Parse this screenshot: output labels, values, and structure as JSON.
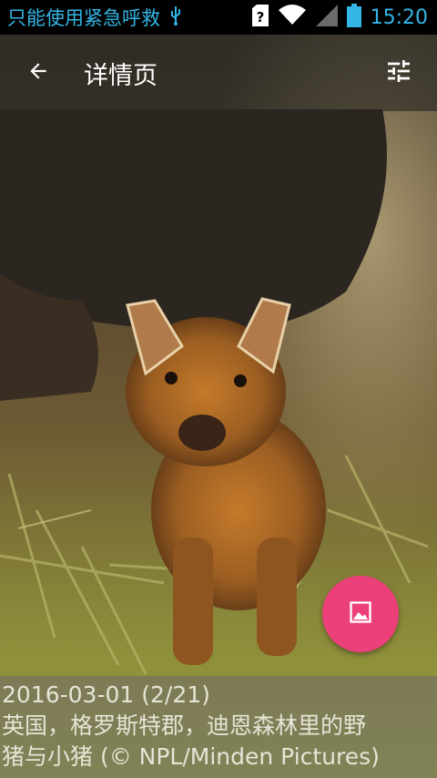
{
  "status_bar": {
    "carrier_text": "只能使用紧急呼救",
    "time": "15:20",
    "icons": [
      "usb-icon",
      "sim-unknown-icon",
      "wifi-icon",
      "signal-icon",
      "battery-icon"
    ]
  },
  "app_bar": {
    "title": "详情页",
    "back_icon": "arrow-back-icon",
    "settings_icon": "tune-icon"
  },
  "fab": {
    "icon": "image-icon",
    "color": "#ec407a"
  },
  "caption": {
    "date_line": "2016-03-01 (2/21)",
    "line2": "英国，格罗斯特郡，迪恩森林里的野",
    "line3": "猪与小猪 (© NPL/Minden Pictures)"
  }
}
